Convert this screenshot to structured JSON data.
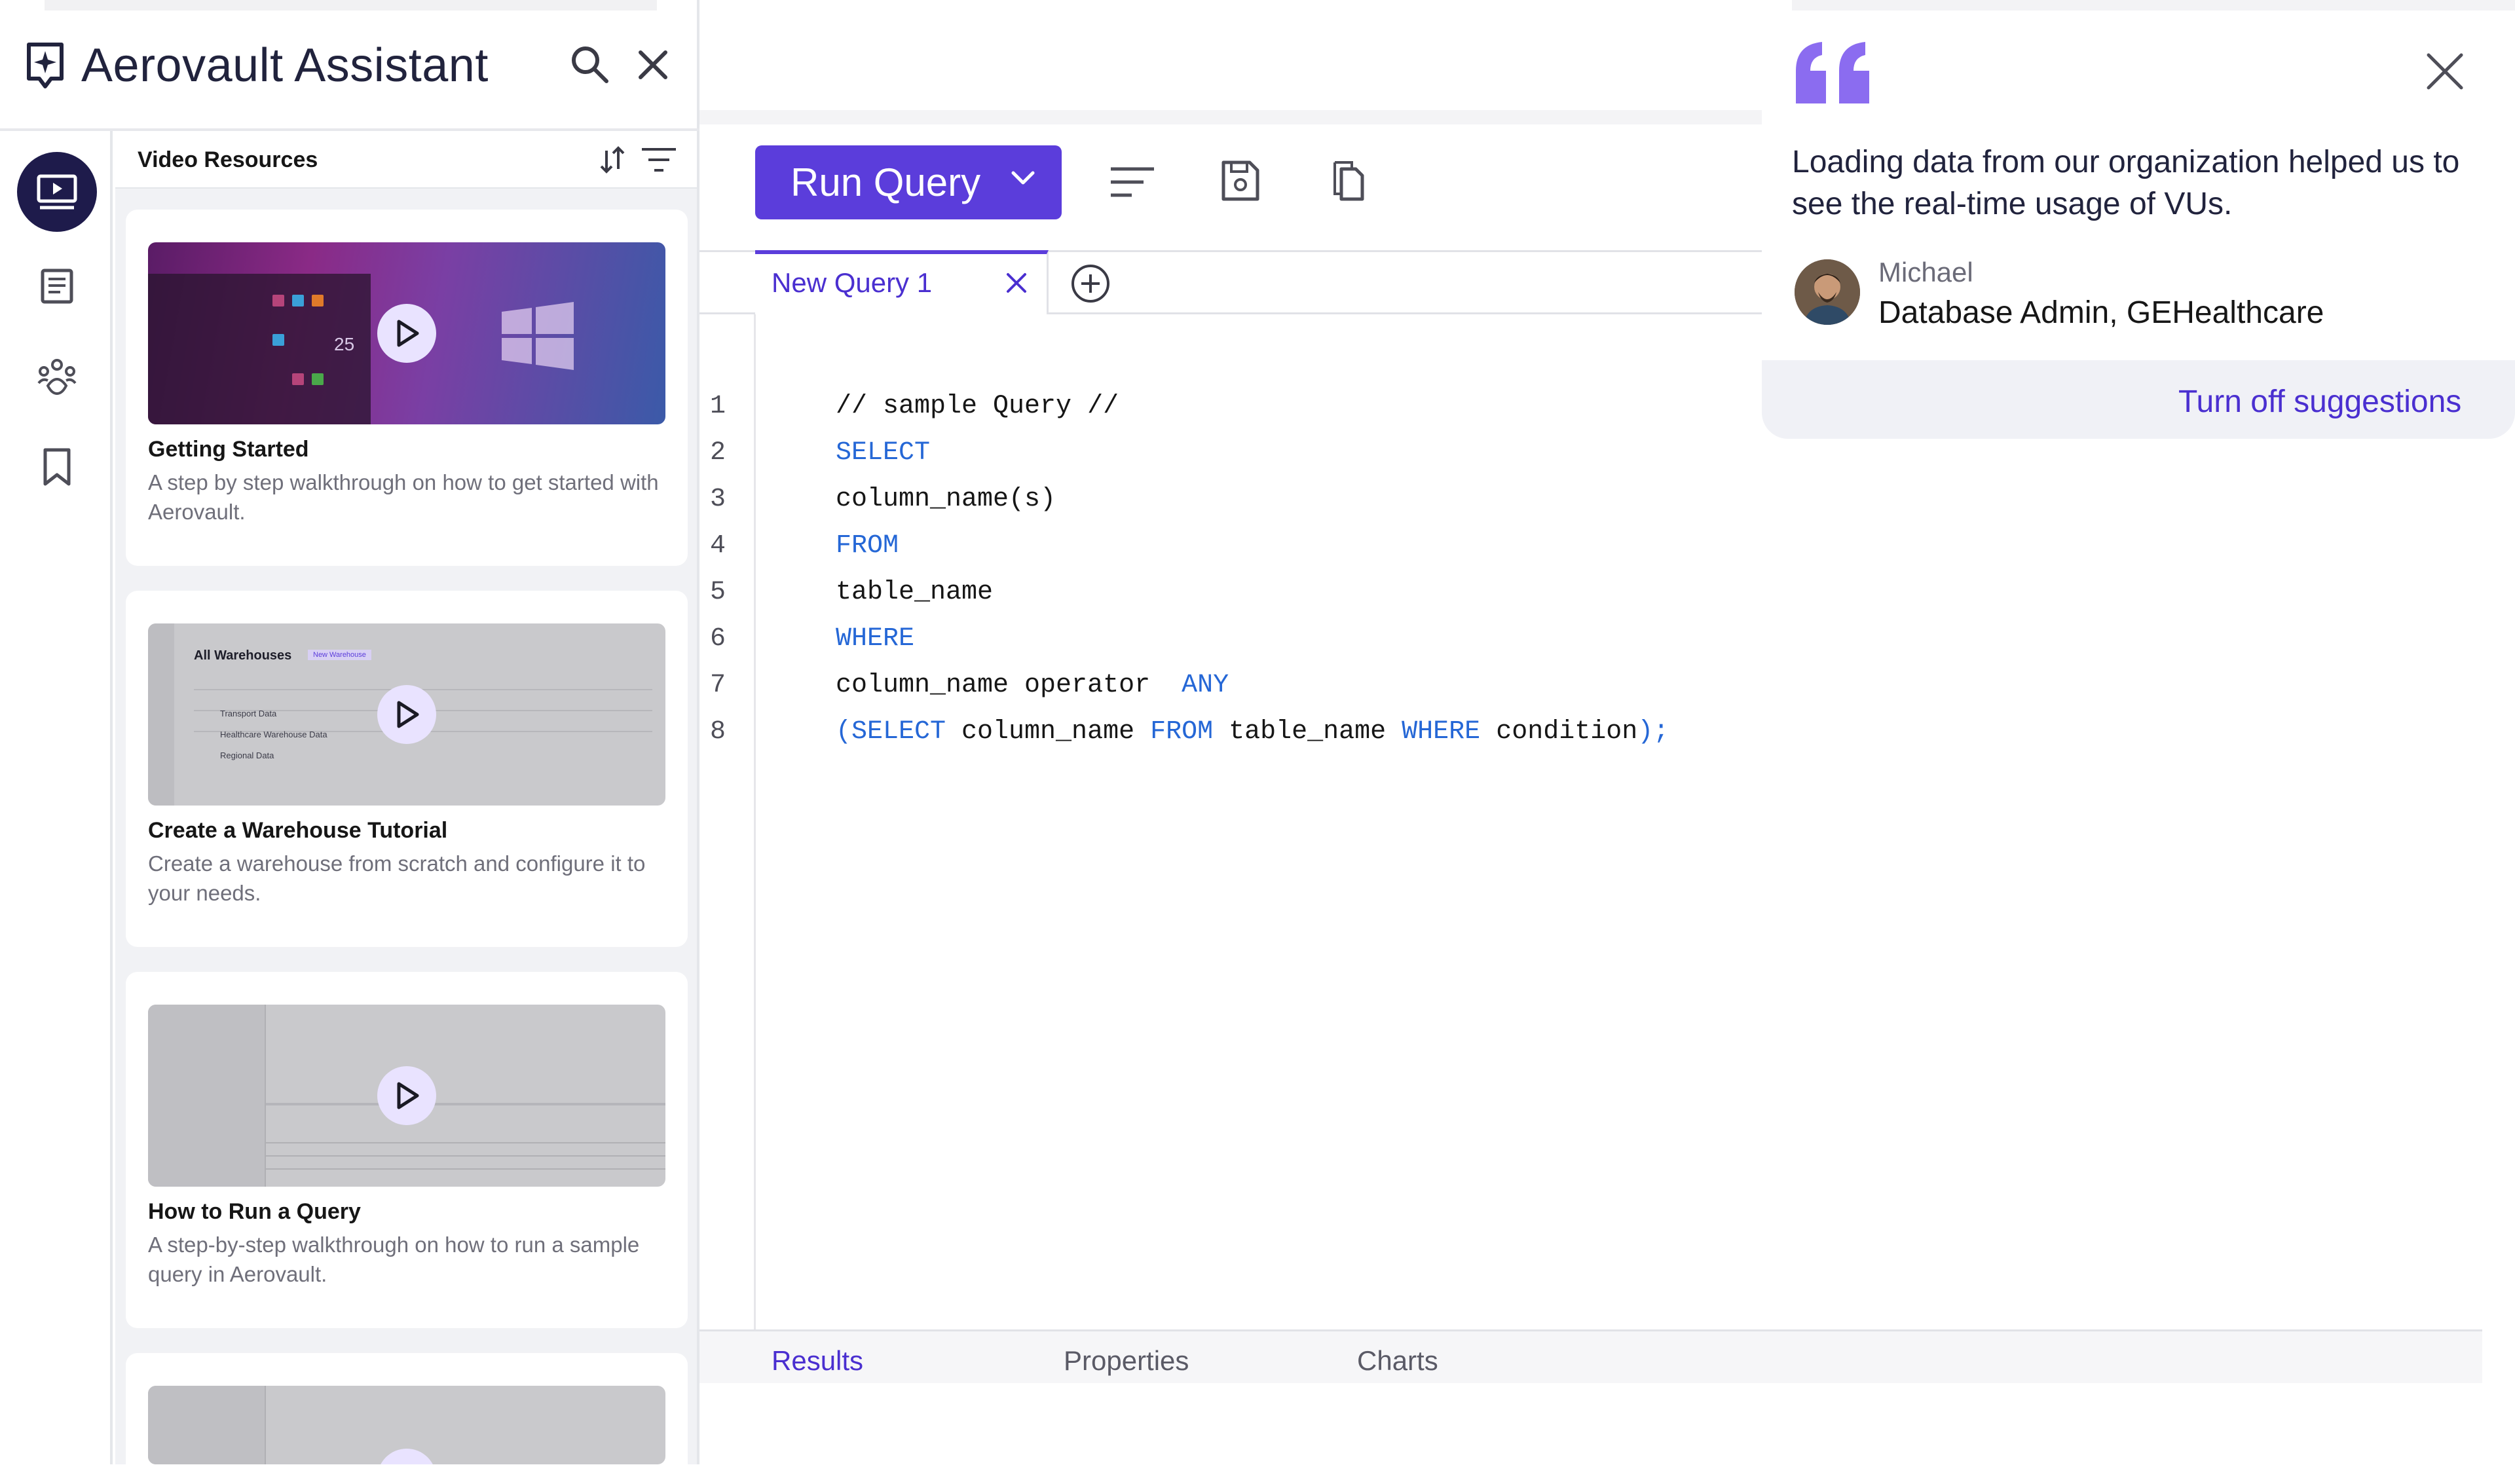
{
  "assistant": {
    "title": "Aerovault Assistant",
    "section_title": "Video Resources",
    "cards": [
      {
        "title": "Getting Started",
        "description": "A step by step walkthrough on how to get started with Aerovault."
      },
      {
        "title": "Create a Warehouse Tutorial",
        "description": "Create a warehouse from scratch and configure it to your needs."
      },
      {
        "title": "How to Run a Query",
        "description": "A step-by-step walkthrough on how to run a sample query in Aerovault."
      }
    ],
    "warehouse_thumb": {
      "heading": "All Warehouses",
      "new_button": "New Warehouse",
      "rows": [
        "Transport Data",
        "Healthcare Warehouse Data",
        "Regional Data"
      ]
    }
  },
  "editor": {
    "run_button": "Run Query",
    "tab_label": "New Query 1",
    "lines": [
      {
        "n": "1",
        "parts": [
          {
            "t": "// sample Query //",
            "k": false
          }
        ]
      },
      {
        "n": "2",
        "parts": [
          {
            "t": "SELECT",
            "k": true
          }
        ]
      },
      {
        "n": "3",
        "parts": [
          {
            "t": "column_name(s)",
            "k": false
          }
        ]
      },
      {
        "n": "4",
        "parts": [
          {
            "t": "FROM",
            "k": true
          }
        ]
      },
      {
        "n": "5",
        "parts": [
          {
            "t": "table_name",
            "k": false
          }
        ]
      },
      {
        "n": "6",
        "parts": [
          {
            "t": "WHERE",
            "k": true
          }
        ]
      },
      {
        "n": "7",
        "parts": [
          {
            "t": "column_name operator  ",
            "k": false
          },
          {
            "t": "ANY",
            "k": true
          }
        ]
      },
      {
        "n": "8",
        "parts": [
          {
            "t": "(SELECT ",
            "k": true
          },
          {
            "t": "column_name ",
            "k": false
          },
          {
            "t": "FROM ",
            "k": true
          },
          {
            "t": "table_name ",
            "k": false
          },
          {
            "t": "WHERE ",
            "k": true
          },
          {
            "t": "condition",
            "k": false
          },
          {
            "t": ");",
            "k": true
          }
        ]
      }
    ],
    "bottom_tabs": {
      "results": "Results",
      "properties": "Properties",
      "charts": "Charts"
    }
  },
  "suggestion": {
    "quote": "Loading data from our organization helped us to see the real-time usage of VUs.",
    "name": "Michael",
    "role": "Database Admin, GEHealthcare",
    "turn_off": "Turn off suggestions"
  },
  "colors": {
    "accent": "#5b3ddb",
    "keyword": "#2567d6",
    "rail_active": "#1e1b4b",
    "quote": "#8b6cf0"
  }
}
